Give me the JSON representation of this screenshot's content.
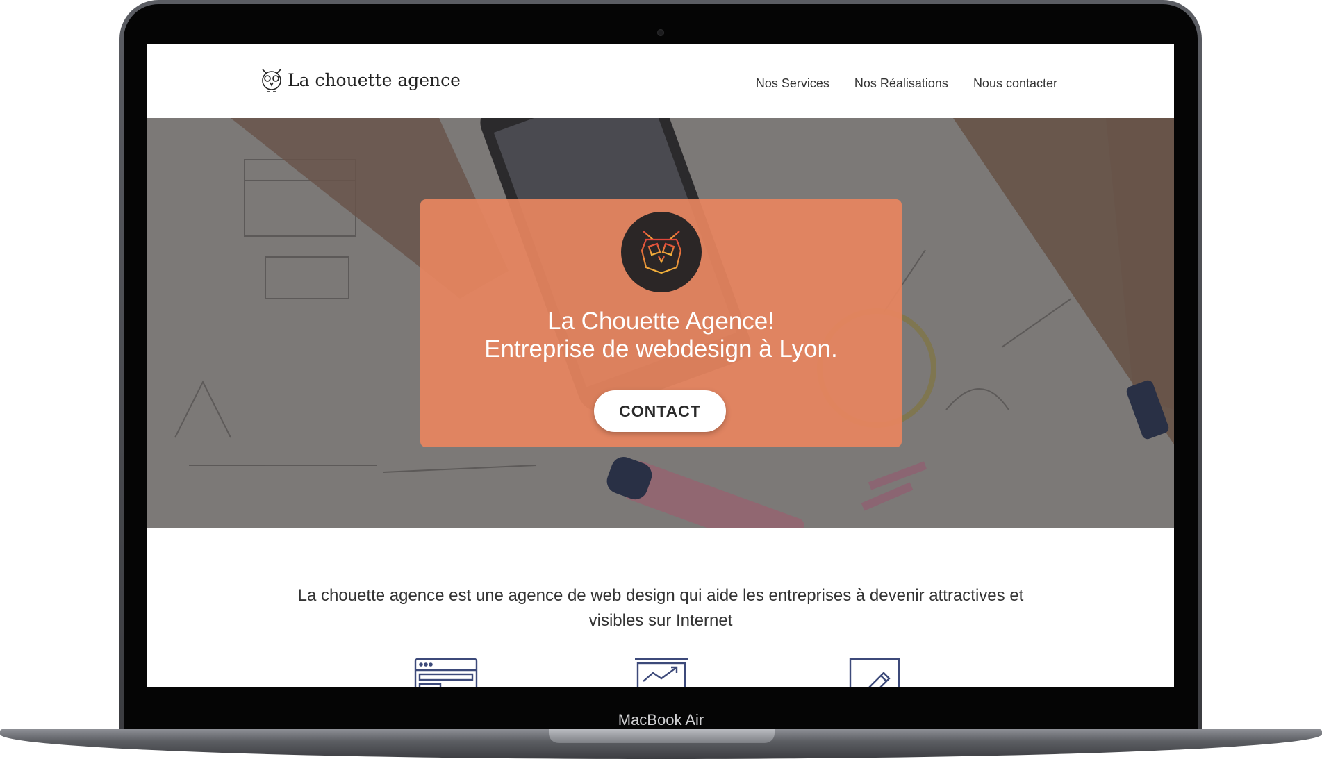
{
  "device": {
    "label": "MacBook Air"
  },
  "site": {
    "logo_text": "La chouette agence",
    "nav": [
      {
        "label": "Nos Services"
      },
      {
        "label": "Nos Réalisations"
      },
      {
        "label": "Nous contacter"
      }
    ],
    "hero": {
      "title_line1": "La Chouette Agence!",
      "title_line2": "Entreprise de webdesign à Lyon.",
      "cta_label": "CONTACT"
    },
    "intro_text": "La chouette agence est une agence de web design qui aide les entreprises à devenir attractives et visibles sur Internet",
    "feature_icons": [
      "browser-window-icon",
      "chart-growth-icon",
      "pencil-edit-icon"
    ]
  },
  "colors": {
    "accent": "#E8855F",
    "badge": "#2B2626",
    "icon_navy": "#3D4A7A"
  }
}
